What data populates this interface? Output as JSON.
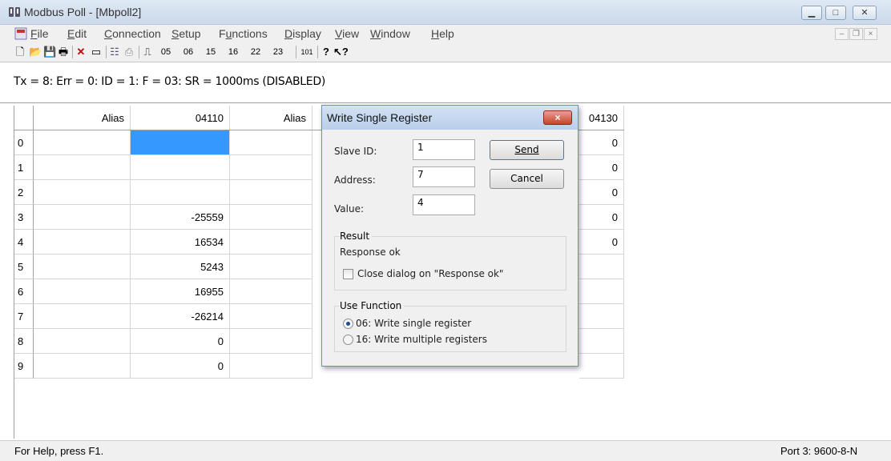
{
  "window": {
    "title": "Modbus Poll - [Mbpoll2]"
  },
  "menu": [
    "File",
    "Edit",
    "Connection",
    "Setup",
    "Functions",
    "Display",
    "View",
    "Window",
    "Help"
  ],
  "menu_underline": [
    "F",
    "E",
    "C",
    "S",
    "u",
    "D",
    "V",
    "W",
    "H"
  ],
  "toolbar": {
    "fc_codes": [
      "05",
      "06",
      "15",
      "16",
      "22",
      "23"
    ],
    "num": "101"
  },
  "txline": "Tx = 8: Err = 0: ID = 1: F = 03: SR = 1000ms  (DISABLED)",
  "grid": {
    "headers": [
      "Alias",
      "04110",
      "Alias",
      "04130"
    ],
    "row_labels": [
      "0",
      "1",
      "2",
      "3",
      "4",
      "5",
      "6",
      "7",
      "8",
      "9"
    ],
    "col_04110": [
      "",
      "",
      "",
      "-25559",
      "16534",
      "5243",
      "16955",
      "-26214",
      "0",
      "0"
    ],
    "col_04130": [
      "0",
      "0",
      "0",
      "0",
      "0",
      "",
      "",
      "",
      "",
      ""
    ]
  },
  "status": {
    "help": "For Help, press F1.",
    "port": "Port 3: 9600-8-N"
  },
  "dialog": {
    "title": "Write Single Register",
    "close_label": "×",
    "slave_label": "Slave ID:",
    "slave_value": "1",
    "address_label": "Address:",
    "address_value": "7",
    "value_label": "Value:",
    "value_value": "4",
    "send_label": "Send",
    "cancel_label": "Cancel",
    "result_group": "Result",
    "result_text": "Response ok",
    "close_on_ok_label": "Close dialog on \"Response ok\"",
    "use_function_group": "Use Function",
    "opt_06": "06: Write single register",
    "opt_16": "16: Write multiple registers"
  },
  "colors": {
    "selected_cell": "#3399ff",
    "close_button": "#c8432c"
  }
}
